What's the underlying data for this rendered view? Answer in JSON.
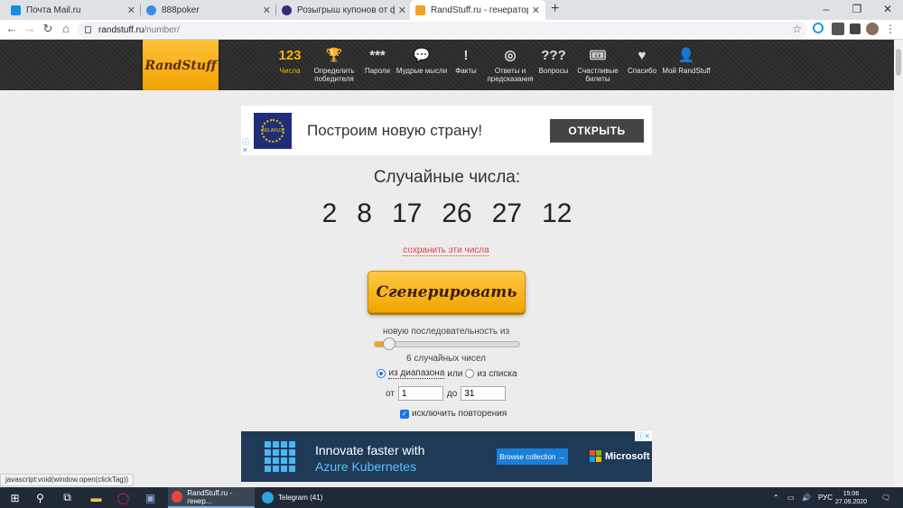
{
  "browser": {
    "tabs": [
      {
        "title": "Почта Mail.ru",
        "icon": "mail-icon",
        "color": "#168de2"
      },
      {
        "title": "888poker",
        "icon": "poker-icon",
        "color": "#3c8ce7"
      },
      {
        "title": "Розыгрыш купонов от форума",
        "icon": "forum-icon",
        "color": "#3a2a7a"
      },
      {
        "title": "RandStuff.ru - генератор случай",
        "icon": "randstuff-icon",
        "color": "#f3a21c"
      }
    ],
    "new_tab": "+",
    "window_controls": [
      "–",
      "❐",
      "✕"
    ],
    "address": {
      "host": "randstuff.ru",
      "path": "/number/"
    },
    "bookmark_star": "☆"
  },
  "site": {
    "logo": "RandStuff",
    "menu": [
      {
        "icon": "123",
        "label": "Числа",
        "active": true
      },
      {
        "icon": "🏆",
        "label": "Определить победителя"
      },
      {
        "icon": "***",
        "label": "Пароли"
      },
      {
        "icon": "💬",
        "label": "Мудрые мысли"
      },
      {
        "icon": "!",
        "label": "Факты"
      },
      {
        "icon": "◎",
        "label": "Ответы и предсказания"
      },
      {
        "icon": "???",
        "label": "Вопросы"
      },
      {
        "icon": "🎟",
        "label": "Счастливые билеты"
      },
      {
        "icon": "♥",
        "label": "Спасибо"
      },
      {
        "icon": "👤",
        "label": "Мой RandStuff"
      }
    ]
  },
  "ad_top": {
    "text": "Построим новую страну!",
    "button": "ОТКРЫТЬ",
    "flag_text": "BELARUS"
  },
  "main": {
    "title": "Случайные числа:",
    "numbers": [
      "2",
      "8",
      "17",
      "26",
      "27",
      "12"
    ],
    "save_link": "сохранить эти числа",
    "generate_button": "Сгенерировать",
    "sequence_label": "новую последовательность из",
    "slider_fraction": 0.1,
    "count_label": "6 случайных чисел",
    "mode_range": "из диапазона",
    "mode_or": "или",
    "mode_list": "из списка",
    "from_label": "от",
    "from_value": "1",
    "to_label": "до",
    "to_value": "31",
    "exclude_repeats": "исключить повторения"
  },
  "ad_bottom": {
    "line1": "Innovate faster with",
    "line2": "Azure Kubernetes",
    "button": "Browse collection →",
    "brand": "Microsoft"
  },
  "status_bar": "javascript:void(window.open(clickTag))",
  "taskbar": {
    "apps": [
      {
        "label": "RandStuff.ru - генер...",
        "color": "#f3a21c"
      },
      {
        "label": "Telegram (41)",
        "color": "#2ca5e0"
      }
    ],
    "language": "РУС",
    "time": "15:06",
    "date": "27.09.2020"
  }
}
